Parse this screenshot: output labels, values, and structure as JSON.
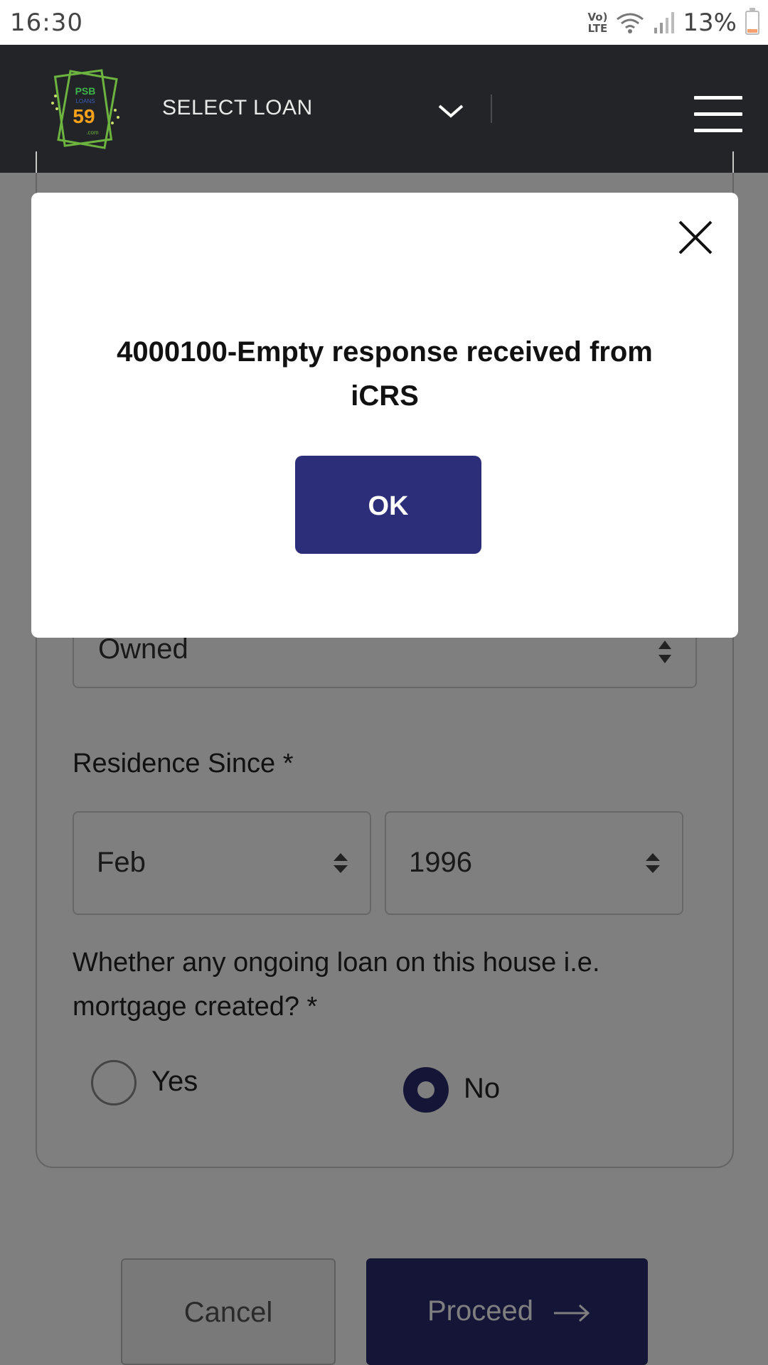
{
  "status_bar": {
    "time": "16:30",
    "network_line1": "Vo)",
    "network_line2": "LTE",
    "battery_percent": "13%"
  },
  "app_bar": {
    "logo": {
      "line1": "PSB",
      "line2": "LOANS",
      "number": "59",
      "suffix": ".com"
    },
    "select_loan_label": "SELECT LOAN"
  },
  "form": {
    "ownership_value": "Owned",
    "residence_since_label": "Residence Since *",
    "residence_month": "Feb",
    "residence_year": "1996",
    "mortgage_question": "Whether any ongoing loan on this house i.e. mortgage created? *",
    "radio_yes_label": "Yes",
    "radio_no_label": "No",
    "selected_option": "No"
  },
  "actions": {
    "cancel_label": "Cancel",
    "proceed_label": "Proceed"
  },
  "dialog": {
    "message": "4000100-Empty response received from iCRS",
    "ok_label": "OK"
  },
  "colors": {
    "primary": "#2a2d6e",
    "header_bg": "#232427",
    "overlay": "rgba(0,0,0,0.5)"
  }
}
